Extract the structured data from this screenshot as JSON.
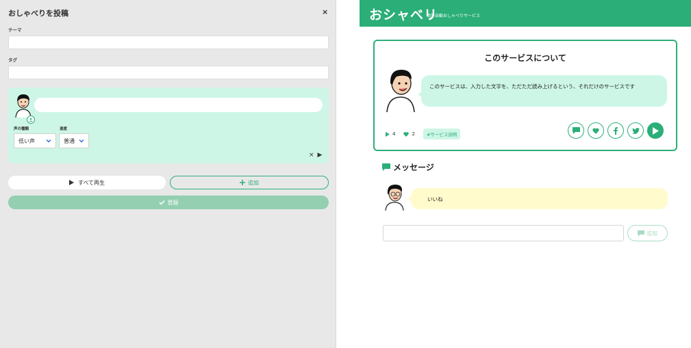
{
  "editor": {
    "title": "おしゃべりを投稿",
    "close_icon": "×",
    "theme_label": "テーマ",
    "theme_value": "",
    "tag_label": "タグ",
    "tag_value": "",
    "line": {
      "text_value": "",
      "voice_type_label": "声の種類",
      "voice_type_value": "低い声",
      "speed_label": "速度",
      "speed_value": "普通",
      "delete_icon": "×",
      "play_icon": "▶"
    },
    "play_all_label": "すべて再生",
    "add_label": "追加",
    "submit_label": "登録"
  },
  "header": {
    "logo": "おシャベリ",
    "tagline": "簡単自動おしゃべりサービス"
  },
  "about": {
    "title": "このサービスについて",
    "bubble_text": "このサービスは、入力した文字を、ただただ読み上げるという、それだけのサービスです",
    "plays": "4",
    "likes": "2",
    "tag": "#サービス説明"
  },
  "messages": {
    "title": "メッセージ",
    "items": [
      {
        "text": "いいね"
      }
    ],
    "input_value": "",
    "add_label": "追加"
  },
  "colors": {
    "brand": "#2bae78",
    "brand_light": "#cdf6e6",
    "message_bubble": "#fffbcc"
  }
}
